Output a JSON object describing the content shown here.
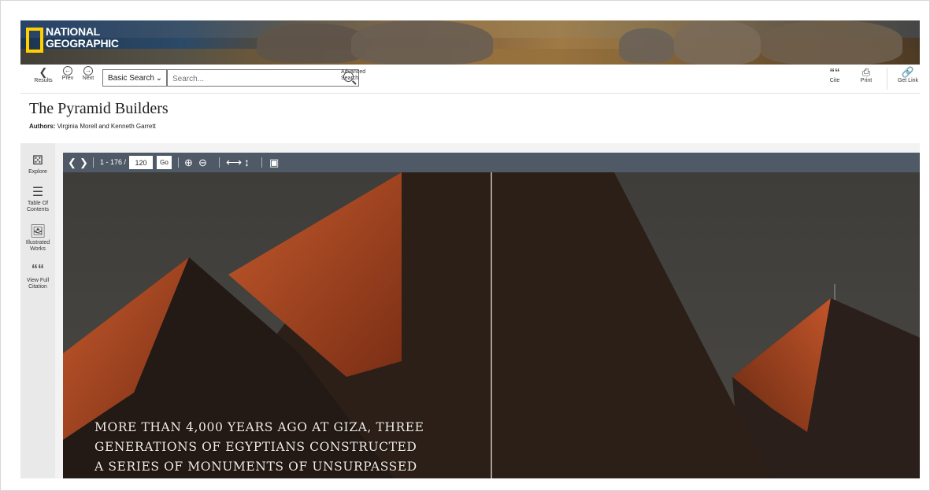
{
  "brand": {
    "line1": "NATIONAL",
    "line2": "GEOGRAPHIC"
  },
  "toolbar": {
    "results_label": "Results",
    "prev_label": "Prev",
    "next_label": "Next",
    "search_type": "Basic Search",
    "search_placeholder": "Search...",
    "advanced_line1": "Advanced",
    "advanced_line2": "Search",
    "cite_label": "Cite",
    "print_label": "Print",
    "getlink_label": "Get Link"
  },
  "document": {
    "title": "The Pyramid Builders",
    "authors_label": "Authors:",
    "authors_value": "Virginia Morell and Kenneth Garrett"
  },
  "sidebar": {
    "items": [
      {
        "label_line1": "Explore",
        "label_line2": "",
        "label_line3": "",
        "icon": "binoculars-icon"
      },
      {
        "label_line1": "Table Of",
        "label_line2": "Contents",
        "label_line3": "",
        "icon": "list-icon"
      },
      {
        "label_line1": "Illustrated",
        "label_line2": "Works",
        "label_line3": "",
        "icon": "image-icon"
      },
      {
        "label_line1": "View Full",
        "label_line2": "Citation",
        "label_line3": "",
        "icon": "quote-icon"
      }
    ]
  },
  "viewer": {
    "page_range": "1 - 176 /",
    "page_value": "120",
    "go_label": "Go"
  },
  "page_image": {
    "caption_lines": [
      "MORE THAN 4,000 YEARS AGO AT GIZA, THREE",
      "GENERATIONS OF EGYPTIANS CONSTRUCTED",
      "A SERIES OF MONUMENTS OF UNSURPASSED"
    ]
  },
  "colors": {
    "viewer_toolbar": "#4f5a66",
    "logo_yellow": "#ffcf00",
    "rail_bg": "#e9e9e9"
  }
}
